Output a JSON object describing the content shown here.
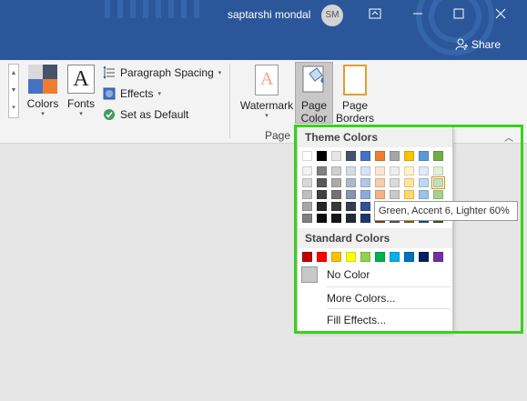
{
  "titlebar": {
    "user_name": "saptarshi mondal",
    "avatar_initials": "SM",
    "share_label": "Share",
    "bg_color": "#2b579a"
  },
  "ribbon": {
    "colors_label": "Colors",
    "fonts_label": "Fonts",
    "fonts_glyph": "A",
    "paragraph_spacing_label": "Paragraph Spacing",
    "effects_label": "Effects",
    "set_default_label": "Set as Default",
    "watermark_label": "Watermark",
    "page_color_label_1": "Page",
    "page_color_label_2": "Color",
    "page_borders_label_1": "Page",
    "page_borders_label_2": "Borders",
    "group_label": "Page B"
  },
  "dropdown": {
    "theme_colors_heading": "Theme Colors",
    "theme_colors": [
      "#ffffff",
      "#000000",
      "#e7e6e6",
      "#44546a",
      "#4472c4",
      "#ed7d31",
      "#a5a5a5",
      "#ffc000",
      "#5b9bd5",
      "#70ad47"
    ],
    "theme_shades": [
      [
        "#f2f2f2",
        "#d9d9d9",
        "#bfbfbf",
        "#a6a6a6",
        "#808080"
      ],
      [
        "#808080",
        "#595959",
        "#404040",
        "#262626",
        "#0d0d0d"
      ],
      [
        "#d0cece",
        "#aeaaaa",
        "#757171",
        "#3a3838",
        "#171616"
      ],
      [
        "#d6dce4",
        "#adb9ca",
        "#8497b0",
        "#333f4f",
        "#222a35"
      ],
      [
        "#d9e2f3",
        "#b4c6e7",
        "#8eaadb",
        "#2f5496",
        "#1f3864"
      ],
      [
        "#fbe5d5",
        "#f7cbac",
        "#f4b183",
        "#c55a11",
        "#833c0b"
      ],
      [
        "#ededed",
        "#dbdbdb",
        "#c9c9c9",
        "#7b7b7b",
        "#525252"
      ],
      [
        "#fff2cc",
        "#fee599",
        "#ffd965",
        "#bf9000",
        "#7f6000"
      ],
      [
        "#deebf6",
        "#bdd7ee",
        "#9dc3e6",
        "#2e75b5",
        "#1e4e79"
      ],
      [
        "#e2efd9",
        "#c5e0b3",
        "#a8d08d",
        "#538135",
        "#375623"
      ]
    ],
    "standard_colors_heading": "Standard Colors",
    "standard_colors": [
      "#c00000",
      "#ff0000",
      "#ffc000",
      "#ffff00",
      "#92d050",
      "#00b050",
      "#00b0f0",
      "#0070c0",
      "#002060",
      "#7030a0"
    ],
    "no_color_label": "No Color",
    "more_colors_label": "More Colors...",
    "fill_effects_label": "Fill Effects..."
  },
  "tooltip": {
    "text": "Green, Accent 6, Lighter 60%"
  },
  "highlight_color": "#3ad11c"
}
